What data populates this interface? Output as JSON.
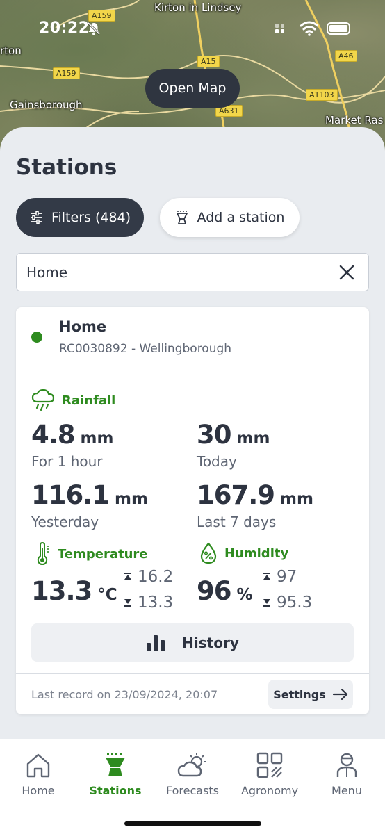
{
  "status_bar": {
    "time": "20:22"
  },
  "map": {
    "places": [
      "Kirton in Lindsey",
      "rton",
      "Gainsborough",
      "Market Ras"
    ],
    "roads": [
      "A159",
      "A15",
      "A46",
      "A159",
      "A1103",
      "A631"
    ],
    "open_map_label": "Open Map"
  },
  "stations": {
    "title": "Stations",
    "filters_label": "Filters (484)",
    "add_station_label": "Add a station",
    "search_value": "Home"
  },
  "station_card": {
    "name": "Home",
    "id_location": "RC0030892 - Wellingborough",
    "status_color": "#2e8b1f",
    "rainfall": {
      "title": "Rainfall",
      "hour_value": "4.8",
      "hour_unit": "mm",
      "hour_label": "For 1 hour",
      "today_value": "30",
      "today_unit": "mm",
      "today_label": "Today",
      "yesterday_value": "116.1",
      "yesterday_unit": "mm",
      "yesterday_label": "Yesterday",
      "week_value": "167.9",
      "week_unit": "mm",
      "week_label": "Last 7 days"
    },
    "temperature": {
      "title": "Temperature",
      "value": "13.3",
      "unit": "°C",
      "max": "16.2",
      "min": "13.3"
    },
    "humidity": {
      "title": "Humidity",
      "value": "96",
      "unit": "%",
      "max": "97",
      "min": "95.3"
    },
    "history_label": "History",
    "last_record": "Last record on 23/09/2024, 20:07",
    "settings_label": "Settings"
  },
  "nav": [
    {
      "label": "Home",
      "icon": "house-icon"
    },
    {
      "label": "Stations",
      "icon": "station-icon",
      "active": true
    },
    {
      "label": "Forecasts",
      "icon": "cloud-sun-icon"
    },
    {
      "label": "Agronomy",
      "icon": "grid-icon"
    },
    {
      "label": "Menu",
      "icon": "person-icon"
    }
  ],
  "colors": {
    "accent": "#2e8b1f",
    "dark": "#333a47",
    "background": "#e9ecf0"
  }
}
